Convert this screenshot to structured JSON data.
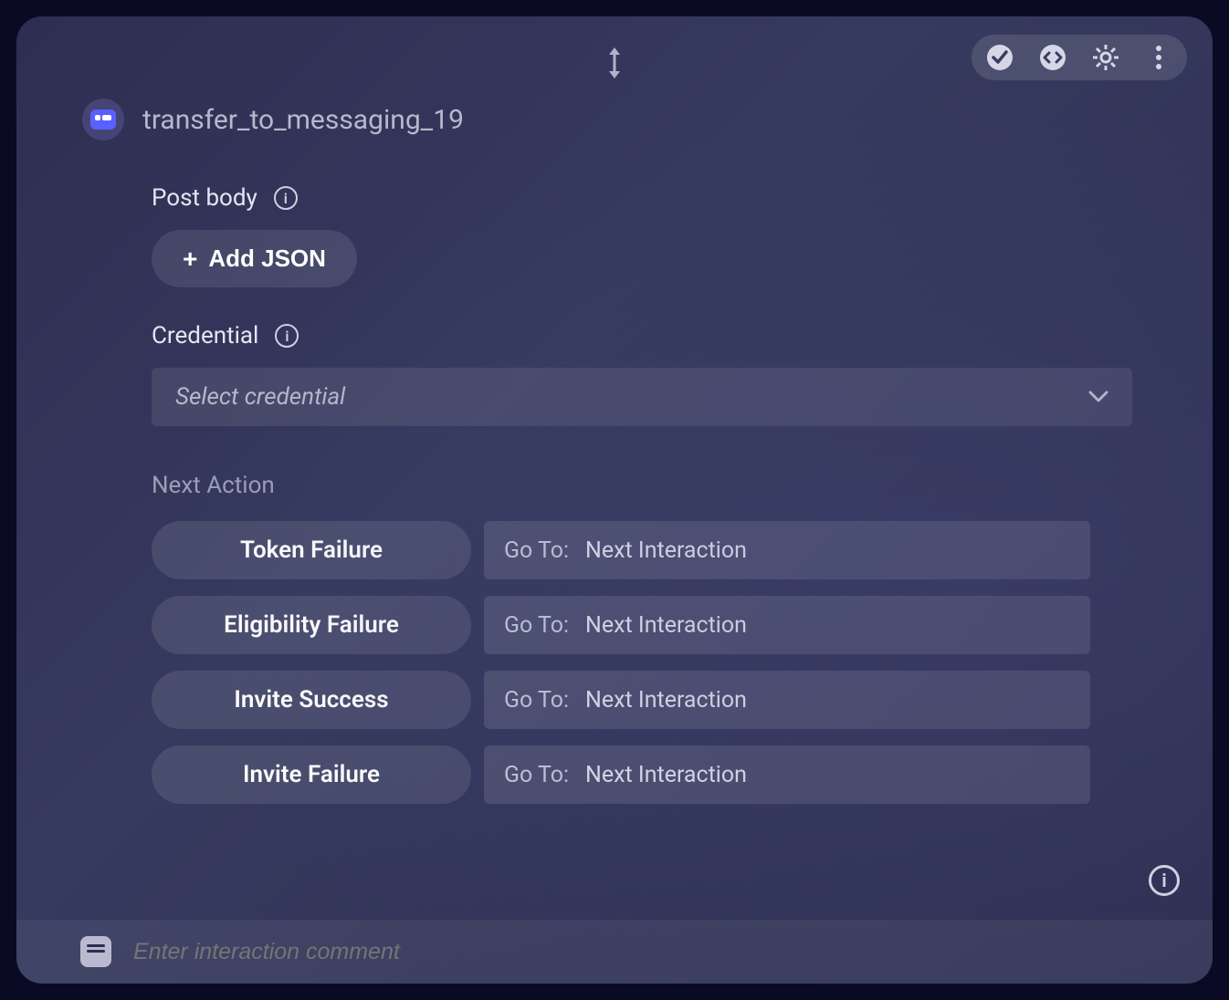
{
  "header": {
    "title": "transfer_to_messaging_19"
  },
  "postBody": {
    "label": "Post body",
    "addButton": "Add JSON"
  },
  "credential": {
    "label": "Credential",
    "placeholder": "Select credential"
  },
  "nextAction": {
    "heading": "Next Action",
    "gotoLabel": "Go To:",
    "rows": [
      {
        "name": "Token Failure",
        "target": "Next Interaction"
      },
      {
        "name": "Eligibility Failure",
        "target": "Next Interaction"
      },
      {
        "name": "Invite Success",
        "target": "Next Interaction"
      },
      {
        "name": "Invite Failure",
        "target": "Next Interaction"
      }
    ]
  },
  "comment": {
    "placeholder": "Enter interaction comment"
  }
}
